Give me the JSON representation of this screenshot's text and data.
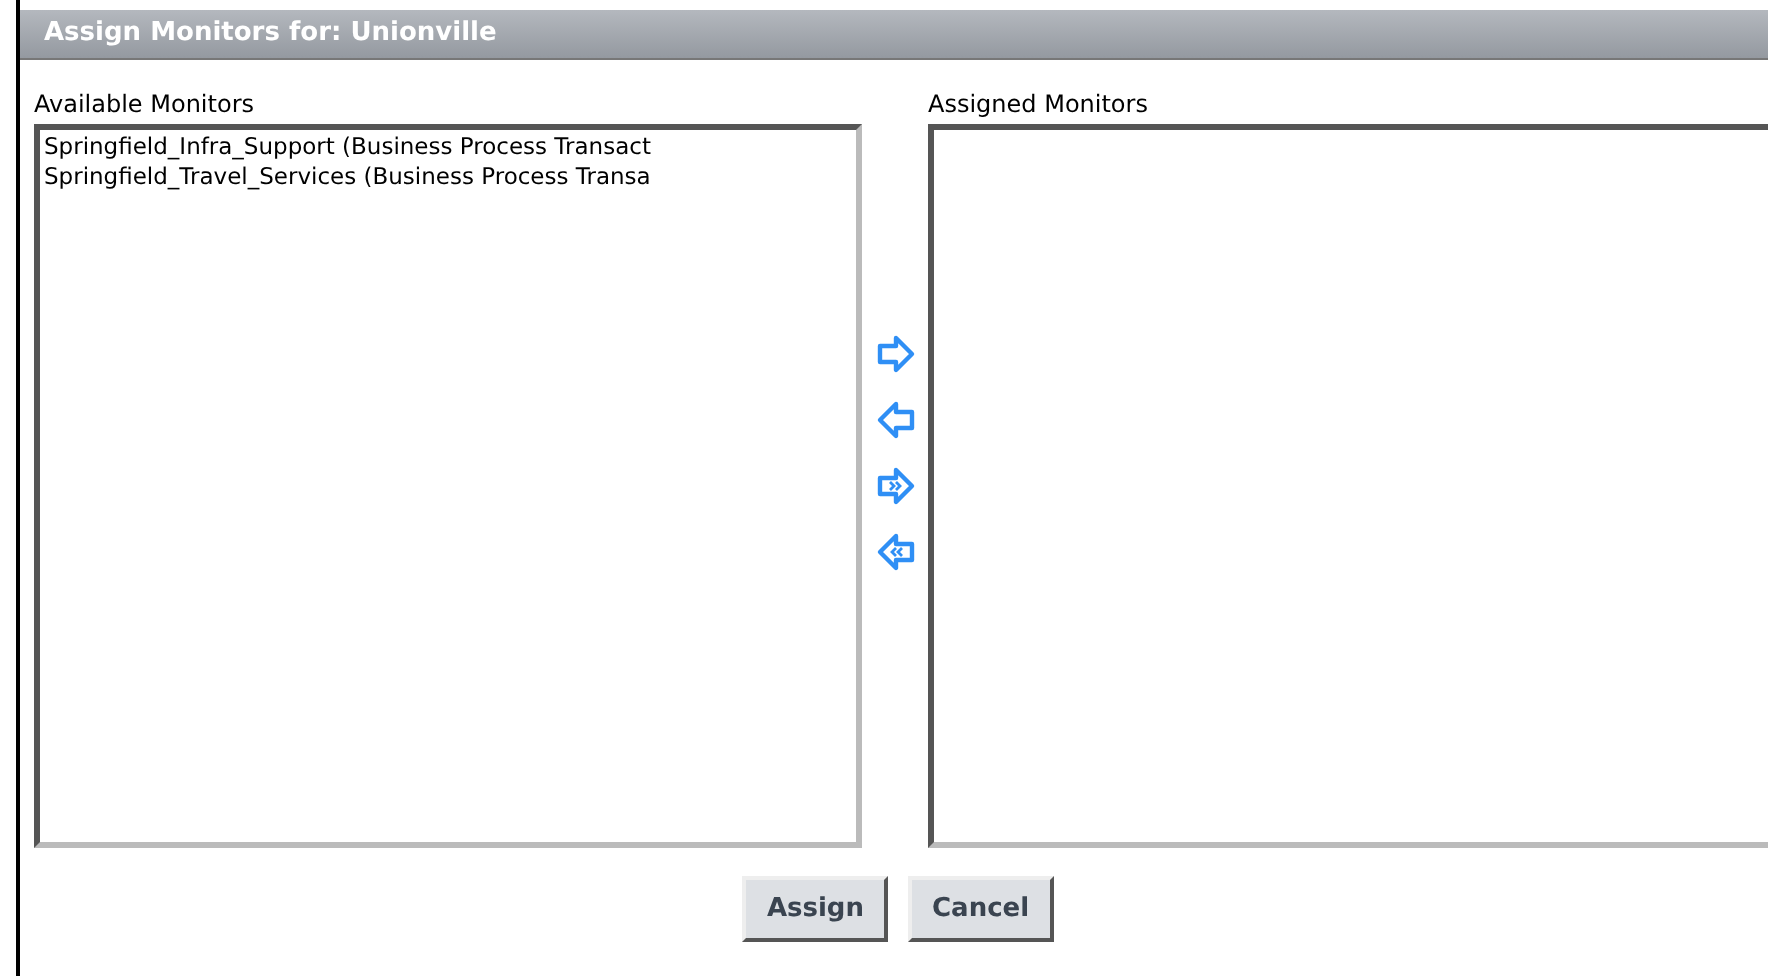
{
  "window": {
    "title": "Assign Monitors for: Unionville"
  },
  "available": {
    "label": "Available Monitors",
    "items": [
      {
        "text": "Springfield_Infra_Support (Business Process Transact"
      },
      {
        "text": "Springfield_Travel_Services (Business Process Transa"
      }
    ]
  },
  "transfer_buttons": [
    {
      "kind": "add"
    },
    {
      "kind": "remove"
    },
    {
      "kind": "add_all"
    },
    {
      "kind": "remove_all"
    }
  ],
  "assigned": {
    "label": "Assigned Monitors"
  },
  "buttons": [
    "Assign",
    "Cancel"
  ]
}
